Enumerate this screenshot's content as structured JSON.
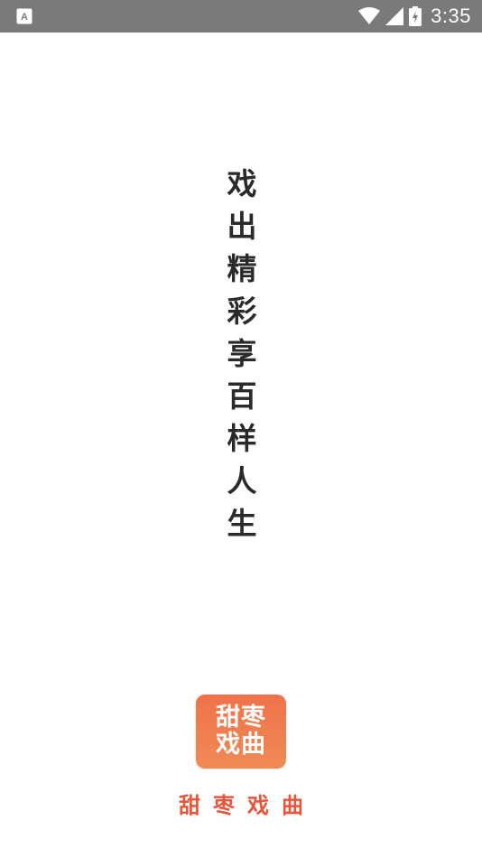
{
  "status_bar": {
    "time": "3:35",
    "notification_icon": "text-a-icon",
    "wifi_icon": "wifi-icon",
    "signal_icon": "cell-signal-icon",
    "battery_icon": "battery-charging-icon",
    "background_color": "#7a7a7a"
  },
  "splash": {
    "slogan": [
      "戏",
      "出",
      "精",
      "彩",
      "享",
      "百",
      "样",
      "人",
      "生"
    ],
    "logo": {
      "line1": "甜枣",
      "line2": "戏曲",
      "color": "#f0784e"
    },
    "app_name": "甜枣戏曲",
    "app_name_color": "#e8553a"
  }
}
